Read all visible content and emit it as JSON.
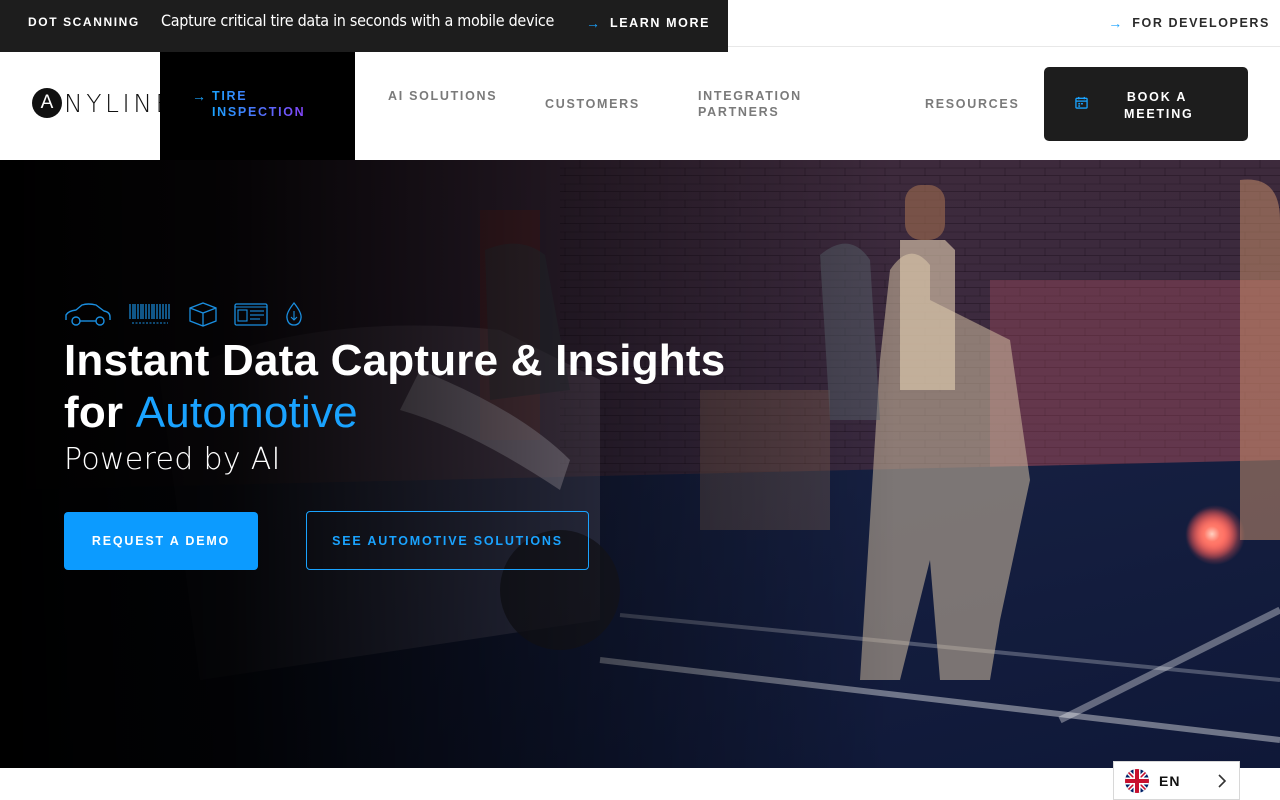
{
  "announcement": {
    "badge": "DOT SCANNING",
    "text": "Capture critical tire data in seconds with a mobile device",
    "link_label": "LEARN MORE",
    "developers_label": "FOR DEVELOPERS"
  },
  "nav": {
    "logo_mark": "A",
    "logo_text": "NYLINE",
    "active_item": "TIRE INSPECTION",
    "items": [
      {
        "label": "AI SOLUTIONS"
      },
      {
        "label": "CUSTOMERS"
      },
      {
        "label": "INTEGRATION PARTNERS"
      },
      {
        "label": "RESOURCES"
      }
    ],
    "cta_label": "BOOK A MEETING"
  },
  "hero": {
    "title_line1": "Instant Data Capture & Insights",
    "title_for": "for",
    "title_accent": "Automotive",
    "subtitle": "Powered by AI",
    "primary_button": "REQUEST A DEMO",
    "secondary_button": "SEE AUTOMOTIVE SOLUTIONS",
    "icons": [
      "car-icon",
      "barcode-icon",
      "package-icon",
      "id-card-icon",
      "droplet-icon"
    ]
  },
  "language": {
    "code": "EN"
  },
  "colors": {
    "accent": "#1aa3ff",
    "dark": "#1d1d1d",
    "gradient_end": "#8b3cf7"
  }
}
